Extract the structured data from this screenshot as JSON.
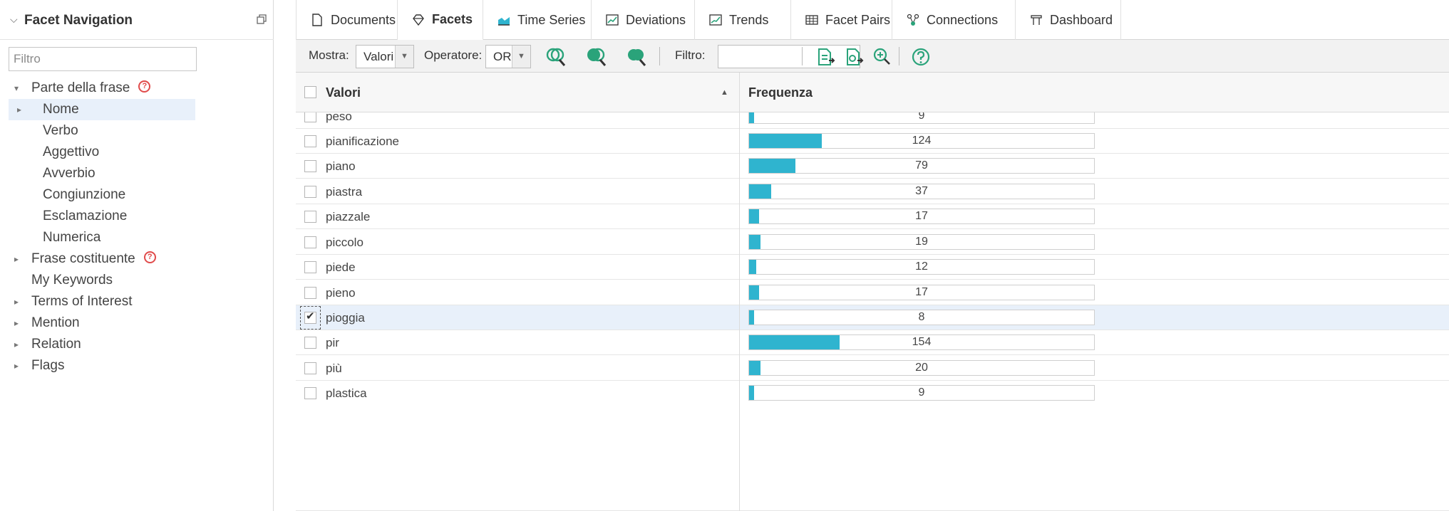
{
  "left_panel": {
    "title": "Facet Navigation",
    "filter_placeholder": "Filtro",
    "tree": [
      {
        "label": "Parte della frase",
        "arrow": "▾",
        "help": true,
        "indent": 0
      },
      {
        "label": "Nome",
        "arrow": "▸",
        "help": false,
        "indent": 1,
        "selected": true
      },
      {
        "label": "Verbo",
        "arrow": "",
        "help": false,
        "indent": 2
      },
      {
        "label": "Aggettivo",
        "arrow": "",
        "help": false,
        "indent": 2
      },
      {
        "label": "Avverbio",
        "arrow": "",
        "help": false,
        "indent": 2
      },
      {
        "label": "Congiunzione",
        "arrow": "",
        "help": false,
        "indent": 2
      },
      {
        "label": "Esclamazione",
        "arrow": "",
        "help": false,
        "indent": 2
      },
      {
        "label": "Numerica",
        "arrow": "",
        "help": false,
        "indent": 2
      },
      {
        "label": "Frase costituente",
        "arrow": "▸",
        "help": true,
        "indent": 0
      },
      {
        "label": "My Keywords",
        "arrow": "",
        "help": false,
        "indent": 0
      },
      {
        "label": "Terms of Interest",
        "arrow": "▸",
        "help": false,
        "indent": 0
      },
      {
        "label": "Mention",
        "arrow": "▸",
        "help": false,
        "indent": 0
      },
      {
        "label": "Relation",
        "arrow": "▸",
        "help": false,
        "indent": 0
      },
      {
        "label": "Flags",
        "arrow": "▸",
        "help": false,
        "indent": 0
      }
    ]
  },
  "tabs": [
    {
      "label": "Documents",
      "icon": "document-icon"
    },
    {
      "label": "Facets",
      "icon": "gem-icon",
      "active": true
    },
    {
      "label": "Time Series",
      "icon": "area-chart-icon"
    },
    {
      "label": "Deviations",
      "icon": "line-chart-icon"
    },
    {
      "label": "Trends",
      "icon": "trend-icon"
    },
    {
      "label": "Facet Pairs",
      "icon": "grid-icon"
    },
    {
      "label": "Connections",
      "icon": "network-icon"
    },
    {
      "label": "Dashboard",
      "icon": "dashboard-icon"
    }
  ],
  "toolbar": {
    "mostra_label": "Mostra:",
    "mostra_value": "Valori",
    "operatore_label": "Operatore:",
    "operatore_value": "OR",
    "filtro_label": "Filtro:",
    "filtro_value": ""
  },
  "table": {
    "col_values": "Valori",
    "col_frequency": "Frequenza",
    "max_value": 154,
    "rows": [
      {
        "term": "peso",
        "value": 9,
        "partial": "top"
      },
      {
        "term": "pianificazione",
        "value": 124
      },
      {
        "term": "piano",
        "value": 79
      },
      {
        "term": "piastra",
        "value": 37
      },
      {
        "term": "piazzale",
        "value": 17
      },
      {
        "term": "piccolo",
        "value": 19
      },
      {
        "term": "piede",
        "value": 12
      },
      {
        "term": "pieno",
        "value": 17
      },
      {
        "term": "pioggia",
        "value": 8,
        "checked": true
      },
      {
        "term": "pir",
        "value": 154
      },
      {
        "term": "più",
        "value": 20
      },
      {
        "term": "plastica",
        "value": 9,
        "partial": "bottom"
      }
    ]
  },
  "colors": {
    "bar_fill": "#2fb4cf",
    "selection": "#e8f0fa",
    "help_red": "#e04b4b",
    "find_green": "#2aa37a"
  }
}
